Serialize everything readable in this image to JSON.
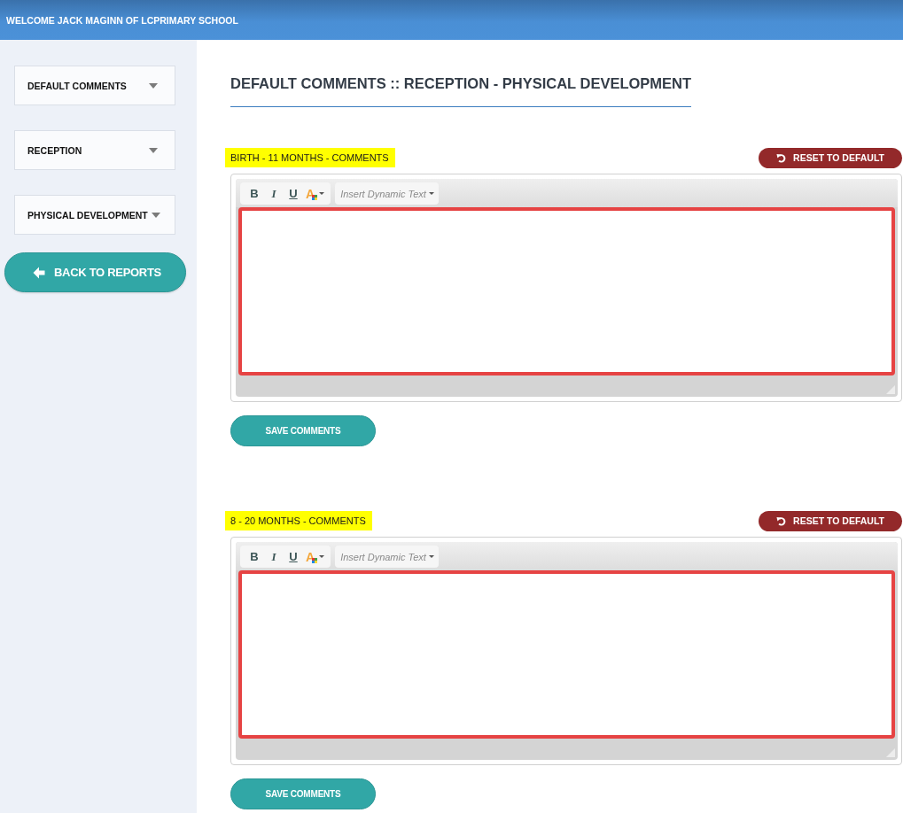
{
  "header": {
    "welcome": "WELCOME JACK MAGINN OF LCPRIMARY SCHOOL"
  },
  "sidebar": {
    "dropdowns": [
      {
        "label": "DEFAULT COMMENTS"
      },
      {
        "label": "RECEPTION"
      },
      {
        "label": "PHYSICAL DEVELOPMENT"
      }
    ],
    "back_button": "BACK TO REPORTS"
  },
  "main": {
    "title": "DEFAULT COMMENTS :: RECEPTION - PHYSICAL DEVELOPMENT",
    "sections": [
      {
        "label": "BIRTH - 11 MONTHS - COMMENTS",
        "reset_button": "RESET TO DEFAULT",
        "toolbar": {
          "bold": "B",
          "italic": "I",
          "underline": "U",
          "font_color": "A",
          "dynamic_text": "Insert Dynamic Text"
        },
        "save_button": "SAVE COMMENTS"
      },
      {
        "label": "8 - 20 MONTHS - COMMENTS",
        "reset_button": "RESET TO DEFAULT",
        "toolbar": {
          "bold": "B",
          "italic": "I",
          "underline": "U",
          "font_color": "A",
          "dynamic_text": "Insert Dynamic Text"
        },
        "save_button": "SAVE COMMENTS"
      }
    ]
  }
}
